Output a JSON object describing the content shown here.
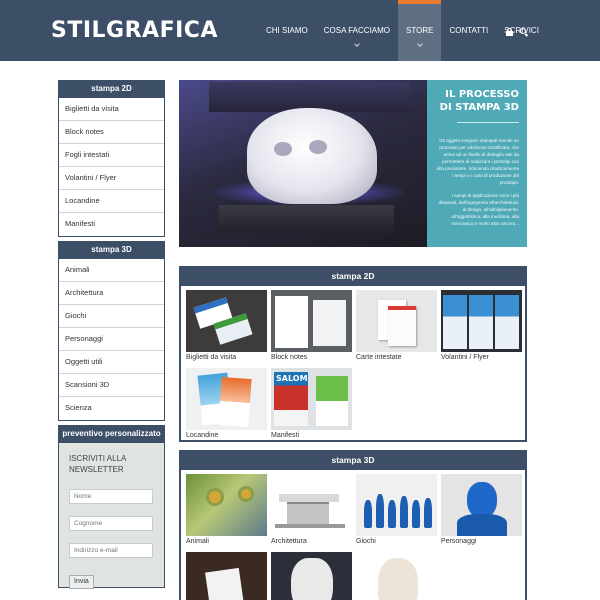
{
  "header": {
    "logo": "STILGRAFICA",
    "nav": [
      {
        "label": "CHI SIAMO",
        "active": false,
        "has_dropdown": false
      },
      {
        "label": "COSA FACCIAMO",
        "active": false,
        "has_dropdown": true
      },
      {
        "label": "STORE",
        "active": true,
        "has_dropdown": true
      },
      {
        "label": "CONTATTI",
        "active": false,
        "has_dropdown": false
      },
      {
        "label": "SCRIVICI",
        "active": false,
        "has_dropdown": false
      }
    ],
    "icons": [
      "lock-icon",
      "search-icon"
    ],
    "colors": {
      "bar": "#3d4f67",
      "active_tab": "#5e6f84",
      "accent": "#e8792e"
    }
  },
  "sidebar": {
    "section_2d": {
      "title": "stampa 2D",
      "items": [
        "Biglietti da visita",
        "Block notes",
        "Fogli intestati",
        "Volantini / Flyer",
        "Locandine",
        "Manifesti"
      ]
    },
    "section_3d": {
      "title": "stampa 3D",
      "items": [
        "Animali",
        "Architettura",
        "Giochi",
        "Personaggi",
        "Oggetti utili",
        "Scansioni 3D",
        "Scienza"
      ]
    },
    "promo": "preventivo personalizzato",
    "newsletter": {
      "title": "ISCRIVITI ALLA NEWSLETTER",
      "name_placeholder": "Nome",
      "surname_placeholder": "Cognome",
      "email_placeholder": "Indirizzo e-mail",
      "button": "Invia"
    }
  },
  "hero": {
    "title_line1": "IL PROCESSO",
    "title_line2": "DI STAMPA 3D",
    "paragraph1": "Gli oggetti vengono stampati tramite un processo per addizione stratificata, che arriva ad un livello di dettaglio tale da permettere di realizzare i prototipi con alta precisione, riducendo drasticamente i tempi e i costi di produzione del prototipo.",
    "paragraph2": "I campi di applicazione sono i più disparati, dall'ingegneria all'architettura, al design, all'abbigliamento, all'oggettistica, alla medicina, alla meccanica e molto altro ancora...",
    "panel_color": "#4fa9b6"
  },
  "box_2d": {
    "title": "stampa 2D",
    "tiles": [
      "Biglietti da visita",
      "Block notes",
      "Carte intestate",
      "Volantini / Flyer",
      "Locandine",
      "Manifesti"
    ]
  },
  "box_3d": {
    "title": "stampa 3D",
    "tiles": [
      "Animali",
      "Architettura",
      "Giochi",
      "Personaggi",
      "",
      "",
      ""
    ]
  }
}
